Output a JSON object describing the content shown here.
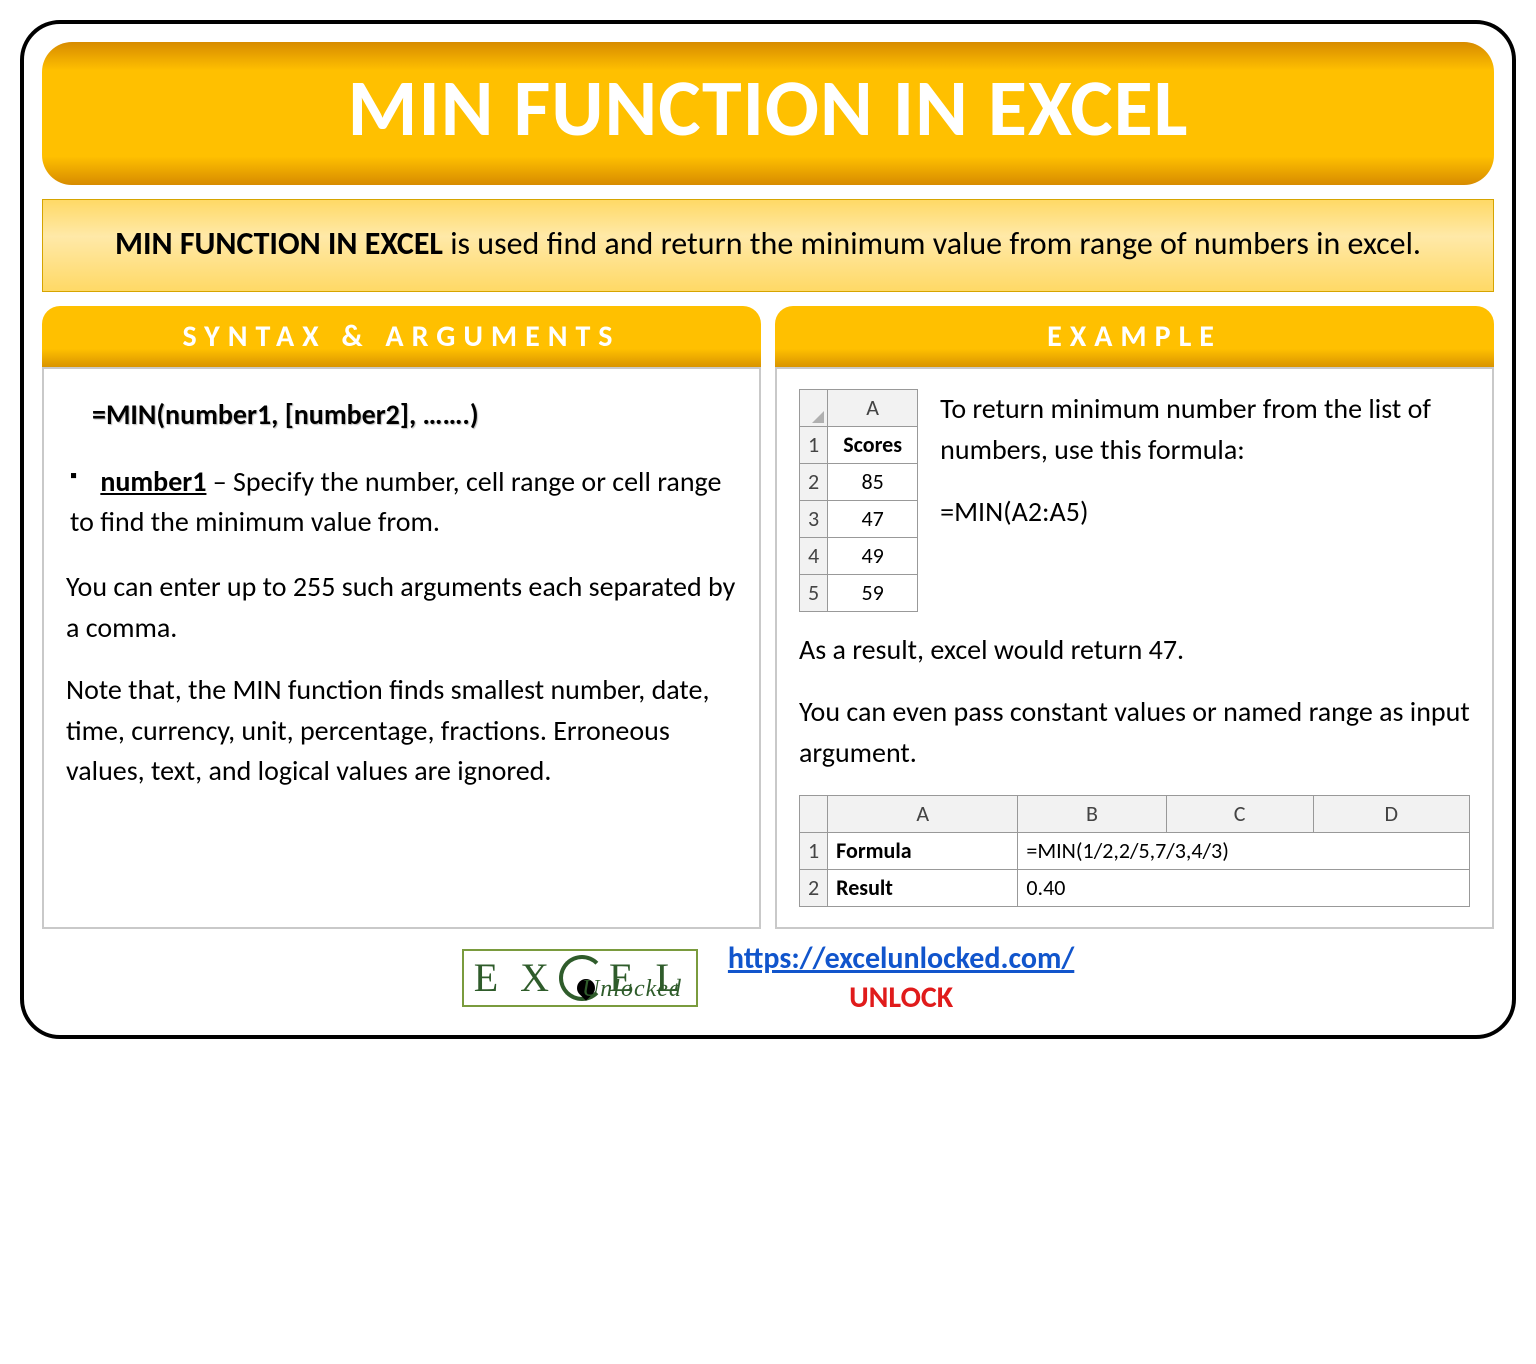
{
  "title": "MIN FUNCTION IN EXCEL",
  "subtitle_bold": "MIN FUNCTION IN EXCEL",
  "subtitle_rest": " is used find and return the minimum value from range of numbers in excel.",
  "syntax": {
    "header": "SYNTAX & ARGUMENTS",
    "formula": "=MIN(number1, [number2], …….)",
    "arg_name": "number1",
    "arg_desc": " – Specify the number, cell range or cell range to find the minimum value from.",
    "para1": "You can enter up to 255 such arguments each separated by a comma.",
    "para2": "Note that, the MIN function finds smallest number, date, time, currency, unit, percentage, fractions. Erroneous values, text, and logical values are ignored."
  },
  "example": {
    "header": "EXAMPLE",
    "table1": {
      "col": "A",
      "rows": [
        "1",
        "2",
        "3",
        "4",
        "5"
      ],
      "header_cell": "Scores",
      "values": [
        "85",
        "47",
        "49",
        "59"
      ]
    },
    "desc1": "To return minimum number from the list of numbers, use this formula:",
    "formula": "=MIN(A2:A5)",
    "result_line": "As a result, excel would return 47.",
    "desc2": "You can even pass constant values or named range as input argument.",
    "table2": {
      "cols": [
        "A",
        "B",
        "C",
        "D"
      ],
      "rows": [
        "1",
        "2"
      ],
      "r1_label": "Formula",
      "r1_val": "=MIN(1/2,2/5,7/3,4/3)",
      "r2_label": "Result",
      "r2_val": "0.40"
    }
  },
  "footer": {
    "logo_top": "EX   EL",
    "logo_sub": "Unlocked",
    "url": "https://excelunlocked.com/",
    "tag": "UNLOCK"
  }
}
